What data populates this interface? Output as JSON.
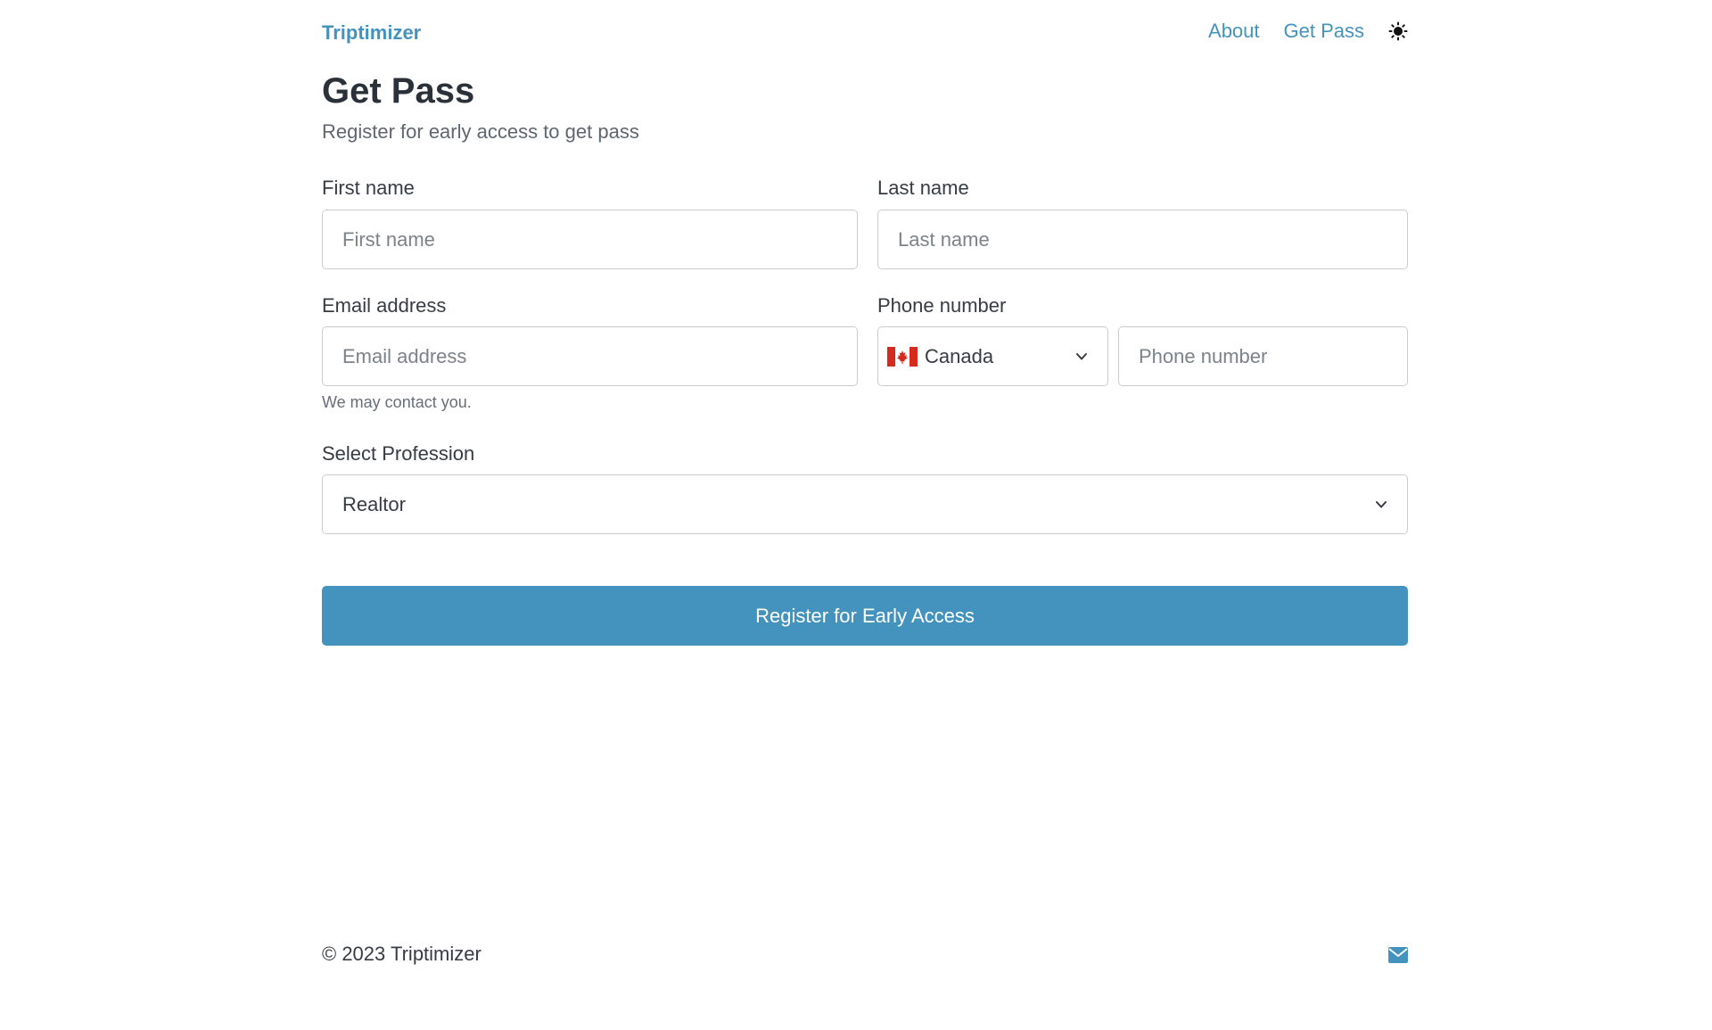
{
  "header": {
    "brand": "Triptimizer",
    "nav": {
      "about": "About",
      "get_pass": "Get Pass"
    },
    "theme_icon": "sun-icon"
  },
  "main": {
    "title": "Get Pass",
    "subtitle": "Register for early access to get pass"
  },
  "form": {
    "first_name": {
      "label": "First name",
      "placeholder": "First name",
      "value": ""
    },
    "last_name": {
      "label": "Last name",
      "placeholder": "Last name",
      "value": ""
    },
    "email": {
      "label": "Email address",
      "placeholder": "Email address",
      "value": "",
      "help": "We may contact you."
    },
    "phone": {
      "label": "Phone number",
      "country": "Canada",
      "country_flag_icon": "canada-flag-icon",
      "placeholder": "Phone number",
      "value": ""
    },
    "profession": {
      "label": "Select Profession",
      "value": "Realtor"
    },
    "submit_label": "Register for Early Access"
  },
  "footer": {
    "copyright": "© 2023 Triptimizer",
    "contact_icon": "envelope-icon"
  },
  "colors": {
    "accent": "#4393be",
    "text": "#373c44",
    "title": "#2b3138",
    "muted": "#5f666f",
    "border": "#c9cdd2",
    "flag_red": "#d52b1e"
  }
}
